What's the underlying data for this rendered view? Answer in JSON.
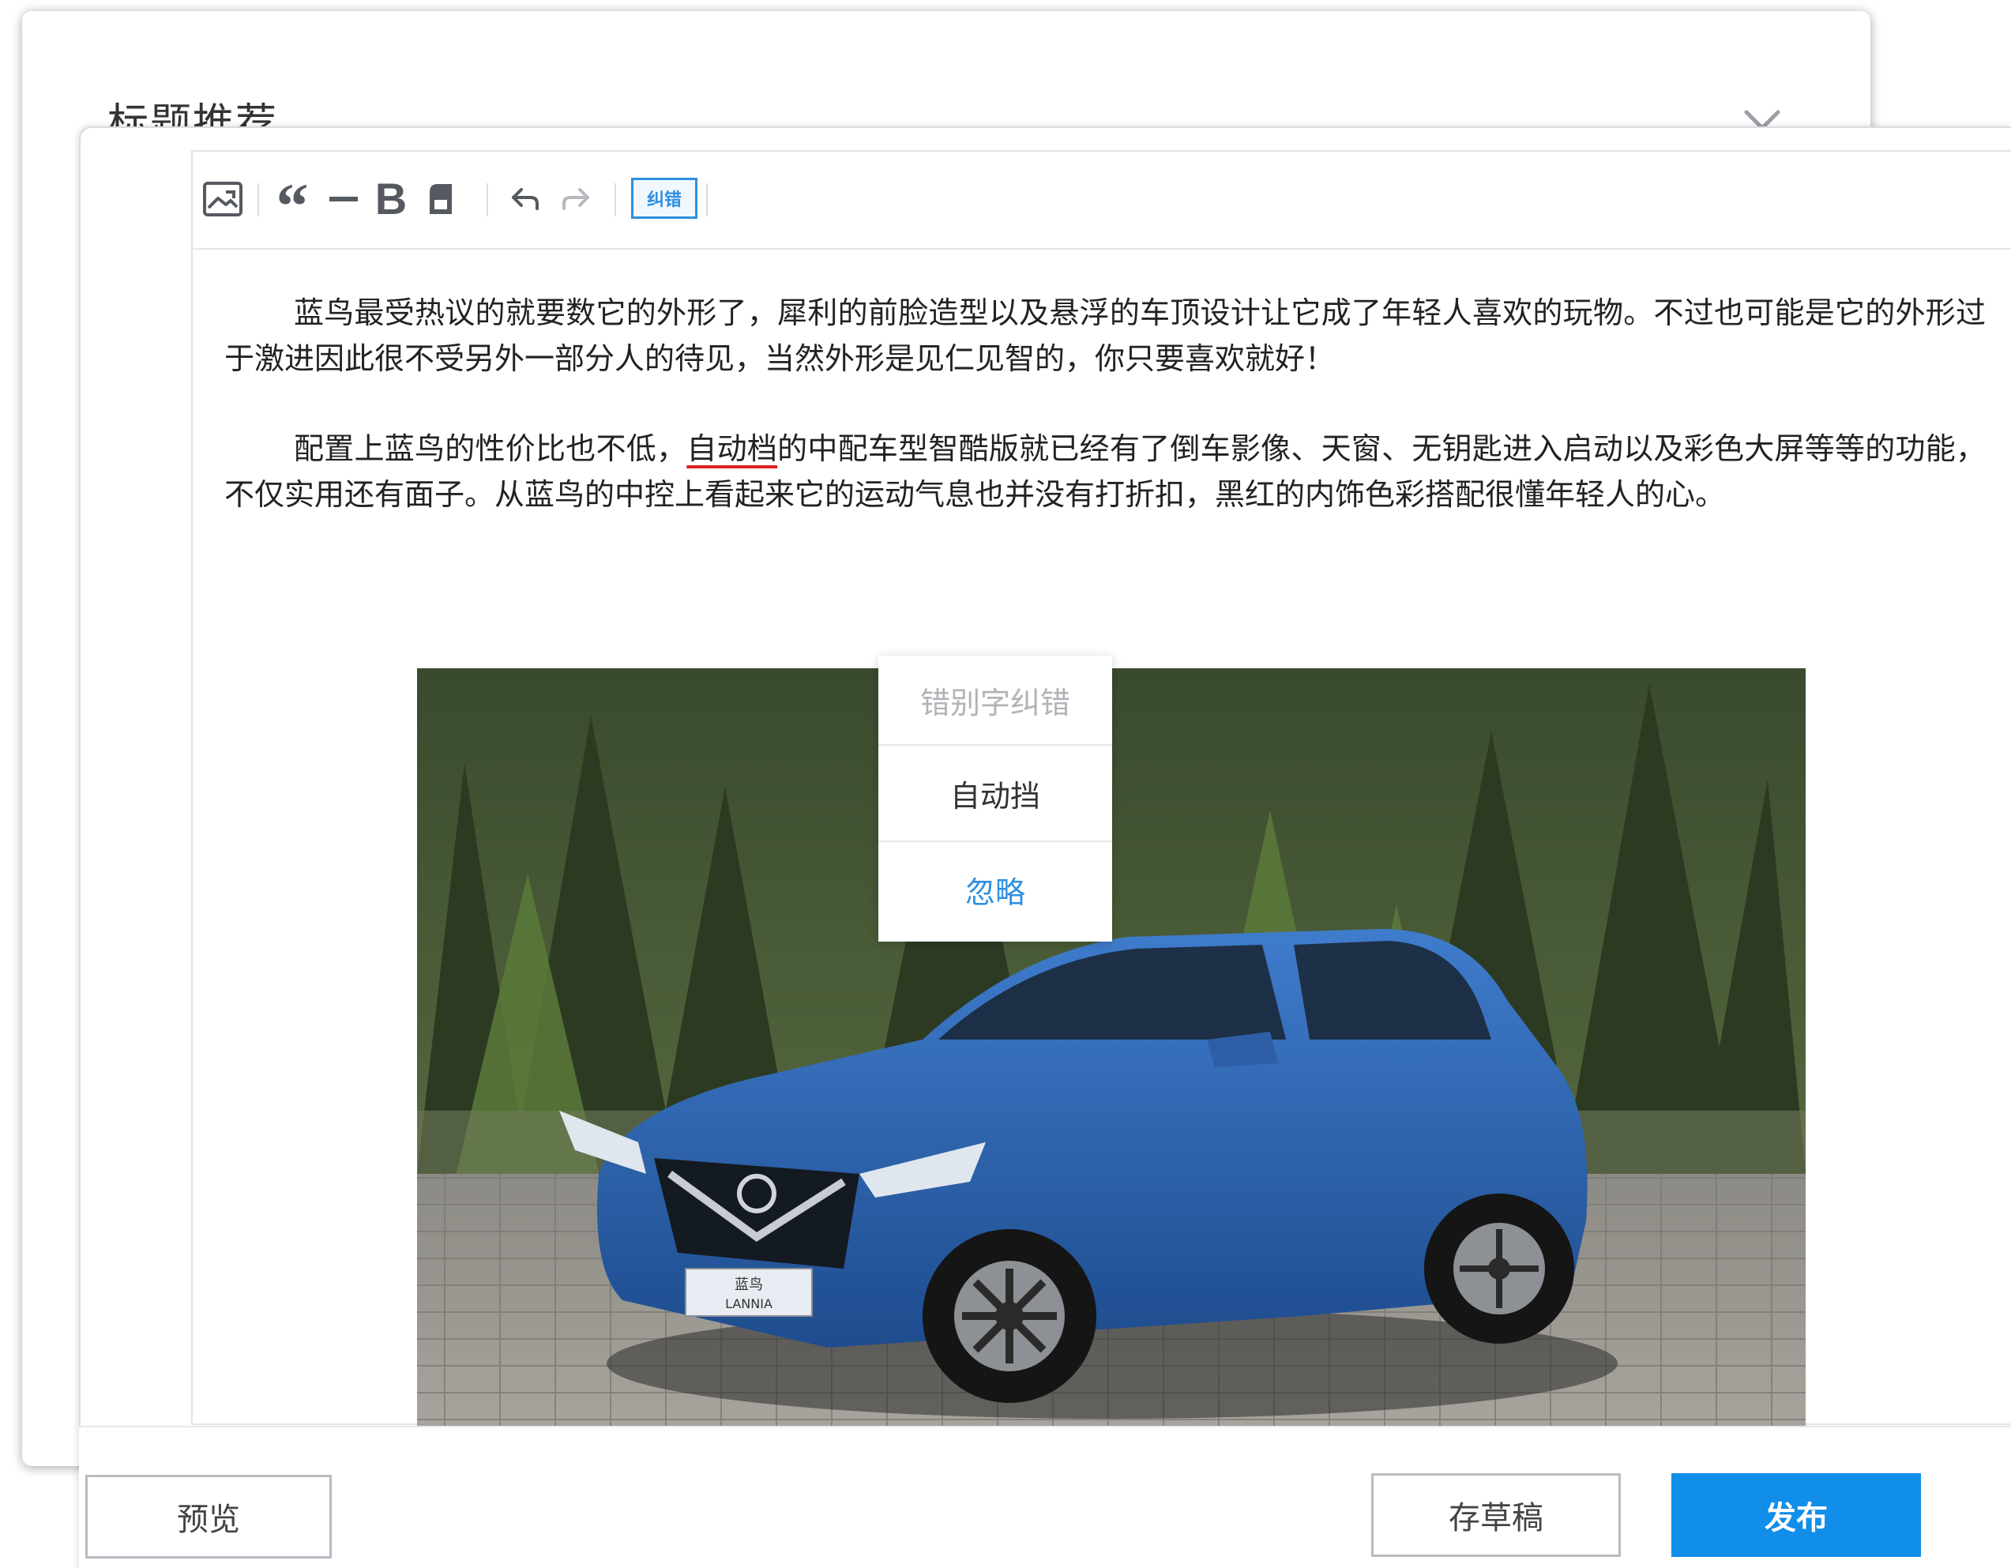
{
  "back_dialog": {
    "title": "标题推荐",
    "close_icon": "close-icon"
  },
  "toolbar": {
    "icons": [
      "image-icon",
      "quote-icon",
      "divider-icon",
      "bold-icon",
      "save-icon",
      "undo-icon",
      "redo-icon"
    ],
    "quote_glyph": "“",
    "bold_glyph": "B",
    "correct_label": "纠错"
  },
  "content": {
    "paragraph1": "蓝鸟最受热议的就要数它的外形了，犀利的前脸造型以及悬浮的车顶设计让它成了年轻人喜欢的玩物。不过也可能是它的外形过于激进因此很不受另外一部分人的待见，当然外形是见仁见智的，你只要喜欢就好！",
    "paragraph2_before": "配置上蓝鸟的性价比也不低，",
    "paragraph2_typo": "自动档",
    "paragraph2_after": "的中配车型智酷版就已经有了倒车影像、天窗、无钥匙进入启动以及彩色大屏等等的功能，不仅实用还有面子。从蓝鸟的中控上看起来它的运动气息也并没有打折扣，黑红的内饰色彩搭配很懂年轻人的心。",
    "photo_plate_line1": "蓝鸟",
    "photo_plate_line2": "LANNIA"
  },
  "popup": {
    "title": "错别字纠错",
    "suggestion": "自动挡",
    "ignore": "忽略"
  },
  "footer": {
    "preview_label": "预览",
    "draft_label": "存草稿",
    "publish_label": "发布"
  },
  "colors": {
    "accent": "#118ee9",
    "link": "#2f8fe0",
    "typo_underline": "#e02020",
    "car_body": "#2a5fa8"
  }
}
